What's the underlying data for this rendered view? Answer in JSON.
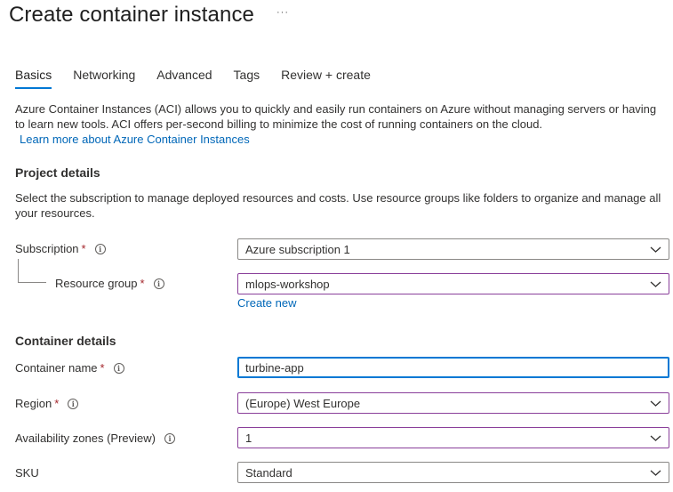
{
  "header": {
    "title": "Create container instance",
    "more_label": "···"
  },
  "tabs": [
    {
      "label": "Basics",
      "active": true
    },
    {
      "label": "Networking",
      "active": false
    },
    {
      "label": "Advanced",
      "active": false
    },
    {
      "label": "Tags",
      "active": false
    },
    {
      "label": "Review + create",
      "active": false
    }
  ],
  "intro": {
    "text": "Azure Container Instances (ACI) allows you to quickly and easily run containers on Azure without managing servers or having to learn new tools. ACI offers per-second billing to minimize the cost of running containers on the cloud.",
    "learn_more": "Learn more about Azure Container Instances"
  },
  "project": {
    "heading": "Project details",
    "description": "Select the subscription to manage deployed resources and costs. Use resource groups like folders to organize and manage all your resources.",
    "subscription_label": "Subscription",
    "subscription_value": "Azure subscription 1",
    "resource_group_label": "Resource group",
    "resource_group_value": "mlops-workshop",
    "create_new": "Create new"
  },
  "container": {
    "heading": "Container details",
    "name_label": "Container name",
    "name_value": "turbine-app",
    "region_label": "Region",
    "region_value": "(Europe) West Europe",
    "zones_label": "Availability zones (Preview)",
    "zones_value": "1",
    "sku_label": "SKU",
    "sku_value": "Standard"
  },
  "common": {
    "required_mark": "*",
    "info_glyph": "i"
  },
  "colors": {
    "accent": "#0078d4",
    "link": "#0067b8",
    "required": "#a4262c",
    "focus_purple": "#8a3f9a"
  }
}
